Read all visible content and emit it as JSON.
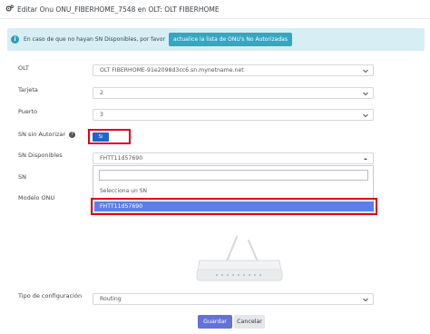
{
  "header": {
    "title": "Editar Onu ONU_FIBERHOME_7548 en OLT: OLT FIBERHOME",
    "icon": "gears-icon"
  },
  "info_banner": {
    "text": "En caso de que no hayan SN Disponibles, por favor",
    "button_label": "actualice la lista de ONU's No Autorizadas",
    "icon": "info-icon"
  },
  "form": {
    "olt": {
      "label": "OLT",
      "value": "OLT FIBERHOME-91e2098d3cc6.sn.mynetname.net"
    },
    "tarjeta": {
      "label": "Tarjeta",
      "value": "2"
    },
    "puerto": {
      "label": "Puerto",
      "value": "3"
    },
    "sn_sin_autorizar": {
      "label": "SN sin Autorizar",
      "toggle_label": "Si",
      "help_icon": "question-icon"
    },
    "sn_disponibles": {
      "label": "SN Disponibles",
      "value": "FHTT11d57690",
      "options": [
        "Selecciona un SN",
        "FHTT11d57690"
      ],
      "search_value": ""
    },
    "sn": {
      "label": "SN"
    },
    "modelo_onu": {
      "label": "Modelo ONU"
    },
    "tipo_configuracion": {
      "label": "Tipo de configuración",
      "value": "Routing"
    }
  },
  "actions": {
    "save_label": "Guardar",
    "cancel_label": "Cancelar"
  },
  "colors": {
    "primary": "#6272d9",
    "info_bg": "#d7eef4",
    "info_button": "#36a6c3",
    "highlight": "#5b7ee8",
    "annotation": "#e00015"
  }
}
